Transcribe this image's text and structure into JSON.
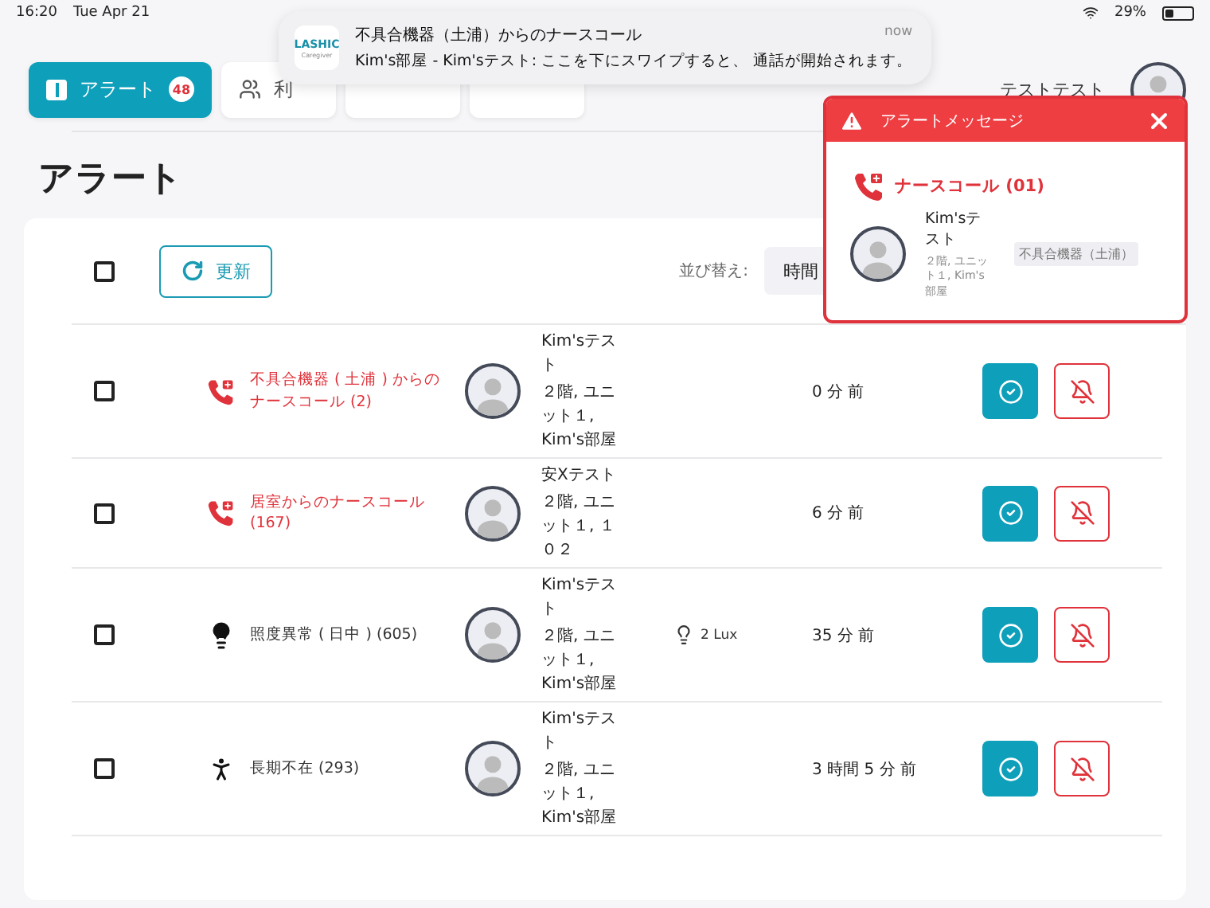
{
  "status_bar": {
    "time": "16:20",
    "date": "Tue Apr 21",
    "battery": "29%"
  },
  "tabs": [
    {
      "label": "アラート",
      "badge": "48",
      "selected": true
    },
    {
      "label": "利",
      "selected": false
    },
    {
      "selected": false
    },
    {
      "selected": false
    }
  ],
  "user": {
    "name": "テストテスト"
  },
  "notification": {
    "app": "LASHIC",
    "app_sub": "Caregiver",
    "title": "不具合機器（土浦）からのナースコール",
    "time": "now",
    "body": "Kim's部屋 - Kim'sテスト: ここを下にスワイプすると、 通話が開始されます。"
  },
  "heading": "アラート",
  "toolbar": {
    "select_all": false,
    "refresh": "更新",
    "sort_label": "並び替え:",
    "sort_value": "時間"
  },
  "rows": [
    {
      "checked": false,
      "kind": "nurse_call",
      "alert": "不具合機器 ( 土浦 ) からのナースコール (2)",
      "name": "Kim'sテスト",
      "location": "２階, ユニット１, Kim's部屋",
      "time": "0 分 前"
    },
    {
      "checked": false,
      "kind": "nurse_call",
      "alert": "居室からのナースコール (167)",
      "name": "安Xテスト",
      "location": "２階, ユニット１, １０２",
      "time": "6 分 前"
    },
    {
      "checked": false,
      "kind": "light",
      "alert": "照度異常 ( 日中 ) (605)",
      "name": "Kim'sテスト",
      "location": "２階, ユニット１, Kim's部屋",
      "reading": "2 Lux",
      "time": "35 分 前"
    },
    {
      "checked": false,
      "kind": "absence",
      "alert": "長期不在 (293)",
      "name": "Kim'sテスト",
      "location": "２階, ユニット１, Kim's部屋",
      "time": "3 時間 5 分 前"
    }
  ],
  "popup": {
    "title": "アラートメッセージ",
    "call": "ナースコール (01)",
    "name": "Kim'sテスト",
    "location": "２階, ユニット１, Kim's部屋",
    "device": "不具合機器（土浦）"
  }
}
